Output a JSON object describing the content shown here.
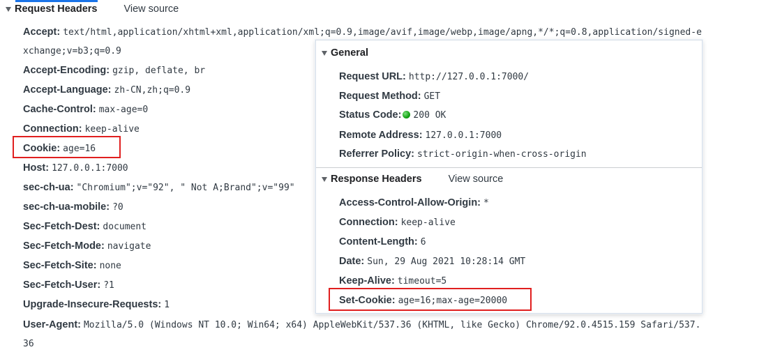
{
  "request_headers": {
    "title": "Request Headers",
    "view_source": "View source",
    "accept": {
      "key": "Accept:",
      "value": "text/html,application/xhtml+xml,application/xml;q=0.9,image/avif,image/webp,image/apng,*/*;q=0.8,application/signed-e",
      "value_cont": "xchange;v=b3;q=0.9"
    },
    "rows": [
      {
        "key": "Accept-Encoding:",
        "value": "gzip, deflate, br"
      },
      {
        "key": "Accept-Language:",
        "value": "zh-CN,zh;q=0.9"
      },
      {
        "key": "Cache-Control:",
        "value": "max-age=0"
      },
      {
        "key": "Connection:",
        "value": "keep-alive"
      },
      {
        "key": "Cookie:",
        "value": "age=16"
      },
      {
        "key": "Host:",
        "value": "127.0.0.1:7000"
      },
      {
        "key": "sec-ch-ua:",
        "value": "\"Chromium\";v=\"92\", \" Not A;Brand\";v=\"99\""
      },
      {
        "key": "sec-ch-ua-mobile:",
        "value": "?0"
      },
      {
        "key": "Sec-Fetch-Dest:",
        "value": "document"
      },
      {
        "key": "Sec-Fetch-Mode:",
        "value": "navigate"
      },
      {
        "key": "Sec-Fetch-Site:",
        "value": "none"
      },
      {
        "key": "Sec-Fetch-User:",
        "value": "?1"
      },
      {
        "key": "Upgrade-Insecure-Requests:",
        "value": "1"
      }
    ],
    "user_agent": {
      "key": "User-Agent:",
      "value": "Mozilla/5.0 (Windows NT 10.0; Win64; x64) AppleWebKit/537.36 (KHTML, like Gecko) Chrome/92.0.4515.159 Safari/537.",
      "value_cont": "36"
    }
  },
  "general": {
    "title": "General",
    "rows": [
      {
        "key": "Request URL:",
        "value": "http://127.0.0.1:7000/"
      },
      {
        "key": "Request Method:",
        "value": "GET"
      },
      {
        "key": "Status Code:",
        "value": "200 OK"
      },
      {
        "key": "Remote Address:",
        "value": "127.0.0.1:7000"
      },
      {
        "key": "Referrer Policy:",
        "value": "strict-origin-when-cross-origin"
      }
    ]
  },
  "response_headers": {
    "title": "Response Headers",
    "view_source": "View source",
    "rows": [
      {
        "key": "Access-Control-Allow-Origin:",
        "value": "*"
      },
      {
        "key": "Connection:",
        "value": "keep-alive"
      },
      {
        "key": "Content-Length:",
        "value": "6"
      },
      {
        "key": "Date:",
        "value": "Sun, 29 Aug 2021 10:28:14 GMT"
      },
      {
        "key": "Keep-Alive:",
        "value": "timeout=5"
      },
      {
        "key": "Set-Cookie:",
        "value": "age=16;max-age=20000"
      }
    ]
  },
  "colors": {
    "highlight_box": "#e01f1f",
    "status_ok": "#12a112",
    "accent": "#1a73e8"
  }
}
